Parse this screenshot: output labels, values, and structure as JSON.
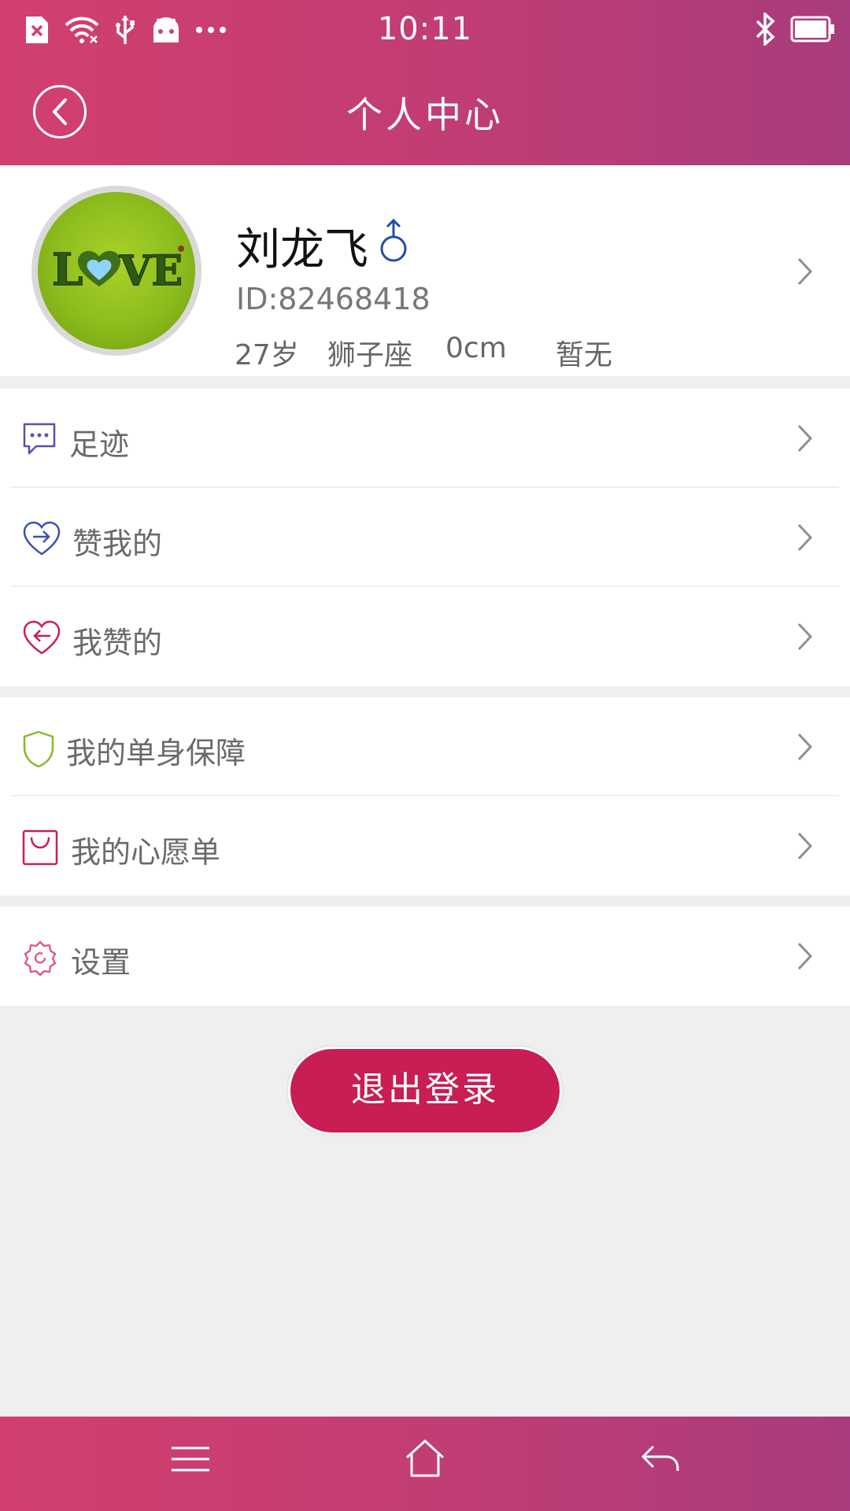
{
  "status_bar": {
    "time": "10:11",
    "icons": [
      "sim-error-icon",
      "wifi-icon",
      "usb-icon",
      "android-icon",
      "more-dots-icon",
      "bluetooth-icon",
      "battery-icon"
    ]
  },
  "header": {
    "title": "个人中心",
    "back_icon": "back-circle-icon",
    "gradient_colors": [
      "#d23f6e",
      "#a93c7c"
    ]
  },
  "profile": {
    "name": "刘龙飞",
    "gender_symbol": "♂",
    "gender_color": "#1f4fa8",
    "id_text": "ID:82468418",
    "age": "27岁",
    "zodiac": "狮子座",
    "height": "0cm",
    "extra": "暂无"
  },
  "menu_sections": [
    {
      "items": [
        {
          "label": "足迹",
          "icon": "chat-bubble-icon",
          "icon_color": "#5a4fb0"
        },
        {
          "label": "赞我的",
          "icon": "heart-in-icon",
          "icon_color": "#3b4fb5"
        },
        {
          "label": "我赞的",
          "icon": "heart-out-icon",
          "icon_color": "#c81e54"
        }
      ]
    },
    {
      "items": [
        {
          "label": "我的单身保障",
          "icon": "shield-icon",
          "icon_color": "#8bb82a"
        },
        {
          "label": "我的心愿单",
          "icon": "shopping-bag-icon",
          "icon_color": "#c81e54"
        }
      ]
    },
    {
      "items": [
        {
          "label": "设置",
          "icon": "gear-icon",
          "icon_color": "#e0557d"
        }
      ]
    }
  ],
  "logout_button": {
    "label": "退出登录",
    "color": "#c81e54"
  },
  "bottom_nav": {
    "icons": [
      "menu-icon",
      "home-icon",
      "back-arrow-icon"
    ]
  }
}
